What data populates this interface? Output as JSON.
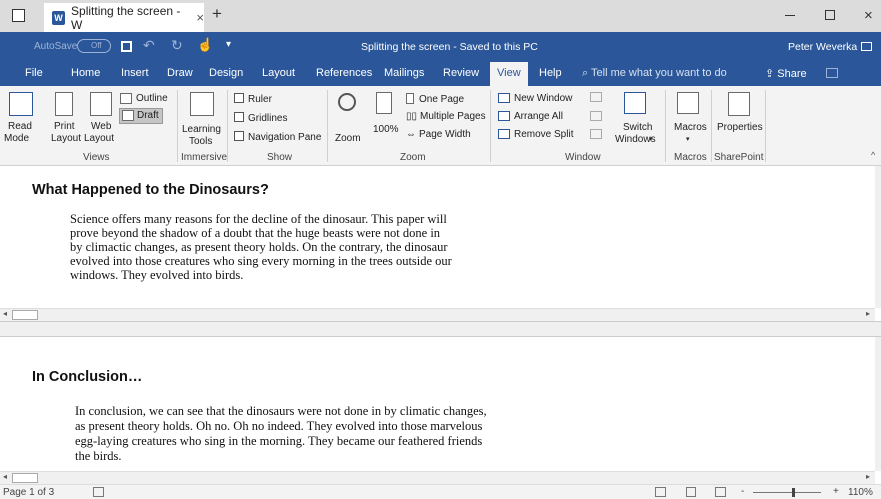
{
  "window": {
    "tab_title": "Splitting the screen - W",
    "new_tab": "+",
    "close_tab": "×",
    "doc_title": "Splitting the screen - Saved to this PC",
    "user": "Peter Weverka"
  },
  "qat": {
    "autosave": "AutoSave",
    "autosave_state": "Off"
  },
  "tabs": [
    "File",
    "Home",
    "Insert",
    "Draw",
    "Design",
    "Layout",
    "References",
    "Mailings",
    "Review",
    "View",
    "Help"
  ],
  "tell_me": "Tell me what you want to do",
  "share": "Share",
  "ribbon": {
    "views": {
      "read_mode": [
        "Read",
        "Mode"
      ],
      "print_layout": [
        "Print",
        "Layout"
      ],
      "web_layout": [
        "Web",
        "Layout"
      ],
      "outline": "Outline",
      "draft": "Draft",
      "label": "Views"
    },
    "immersive": {
      "learning_tools": [
        "Learning",
        "Tools"
      ],
      "label": "Immersive"
    },
    "show": {
      "ruler": "Ruler",
      "gridlines": "Gridlines",
      "navigation_pane": "Navigation Pane",
      "label": "Show"
    },
    "zoom": {
      "zoom": "Zoom",
      "hundred": "100%",
      "one_page": "One Page",
      "multiple_pages": "Multiple Pages",
      "page_width": "Page Width",
      "label": "Zoom"
    },
    "window": {
      "new_window": "New Window",
      "arrange_all": "Arrange All",
      "remove_split": "Remove Split",
      "switch_windows": [
        "Switch",
        "Windows"
      ],
      "label": "Window"
    },
    "macros": {
      "macros": "Macros",
      "label": "Macros"
    },
    "sharepoint": {
      "properties": "Properties",
      "label": "SharePoint"
    }
  },
  "top_pane": {
    "heading": "What Happened to the Dinosaurs?",
    "lines": [
      "Science offers many reasons for the decline of the dinosaur. This paper will",
      "prove beyond the shadow of a doubt that the huge beasts were not done in",
      "by climactic changes, as present theory holds. On the contrary, the dinosaur",
      "evolved into those creatures who sing every morning in the trees outside our",
      "windows. They evolved into birds."
    ]
  },
  "bottom_pane": {
    "heading": "In Conclusion…",
    "lines": [
      "In conclusion, we can see that the dinosaurs were not done in by climatic changes,",
      "as present theory holds. Oh no. Oh no indeed. They evolved into those marvelous",
      "egg-laying creatures who sing in the morning. They became our feathered friends",
      "the birds."
    ]
  },
  "status": {
    "page": "Page 1 of 3",
    "zoom_minus": "-",
    "zoom_plus": "+",
    "zoom_level": "110%"
  }
}
